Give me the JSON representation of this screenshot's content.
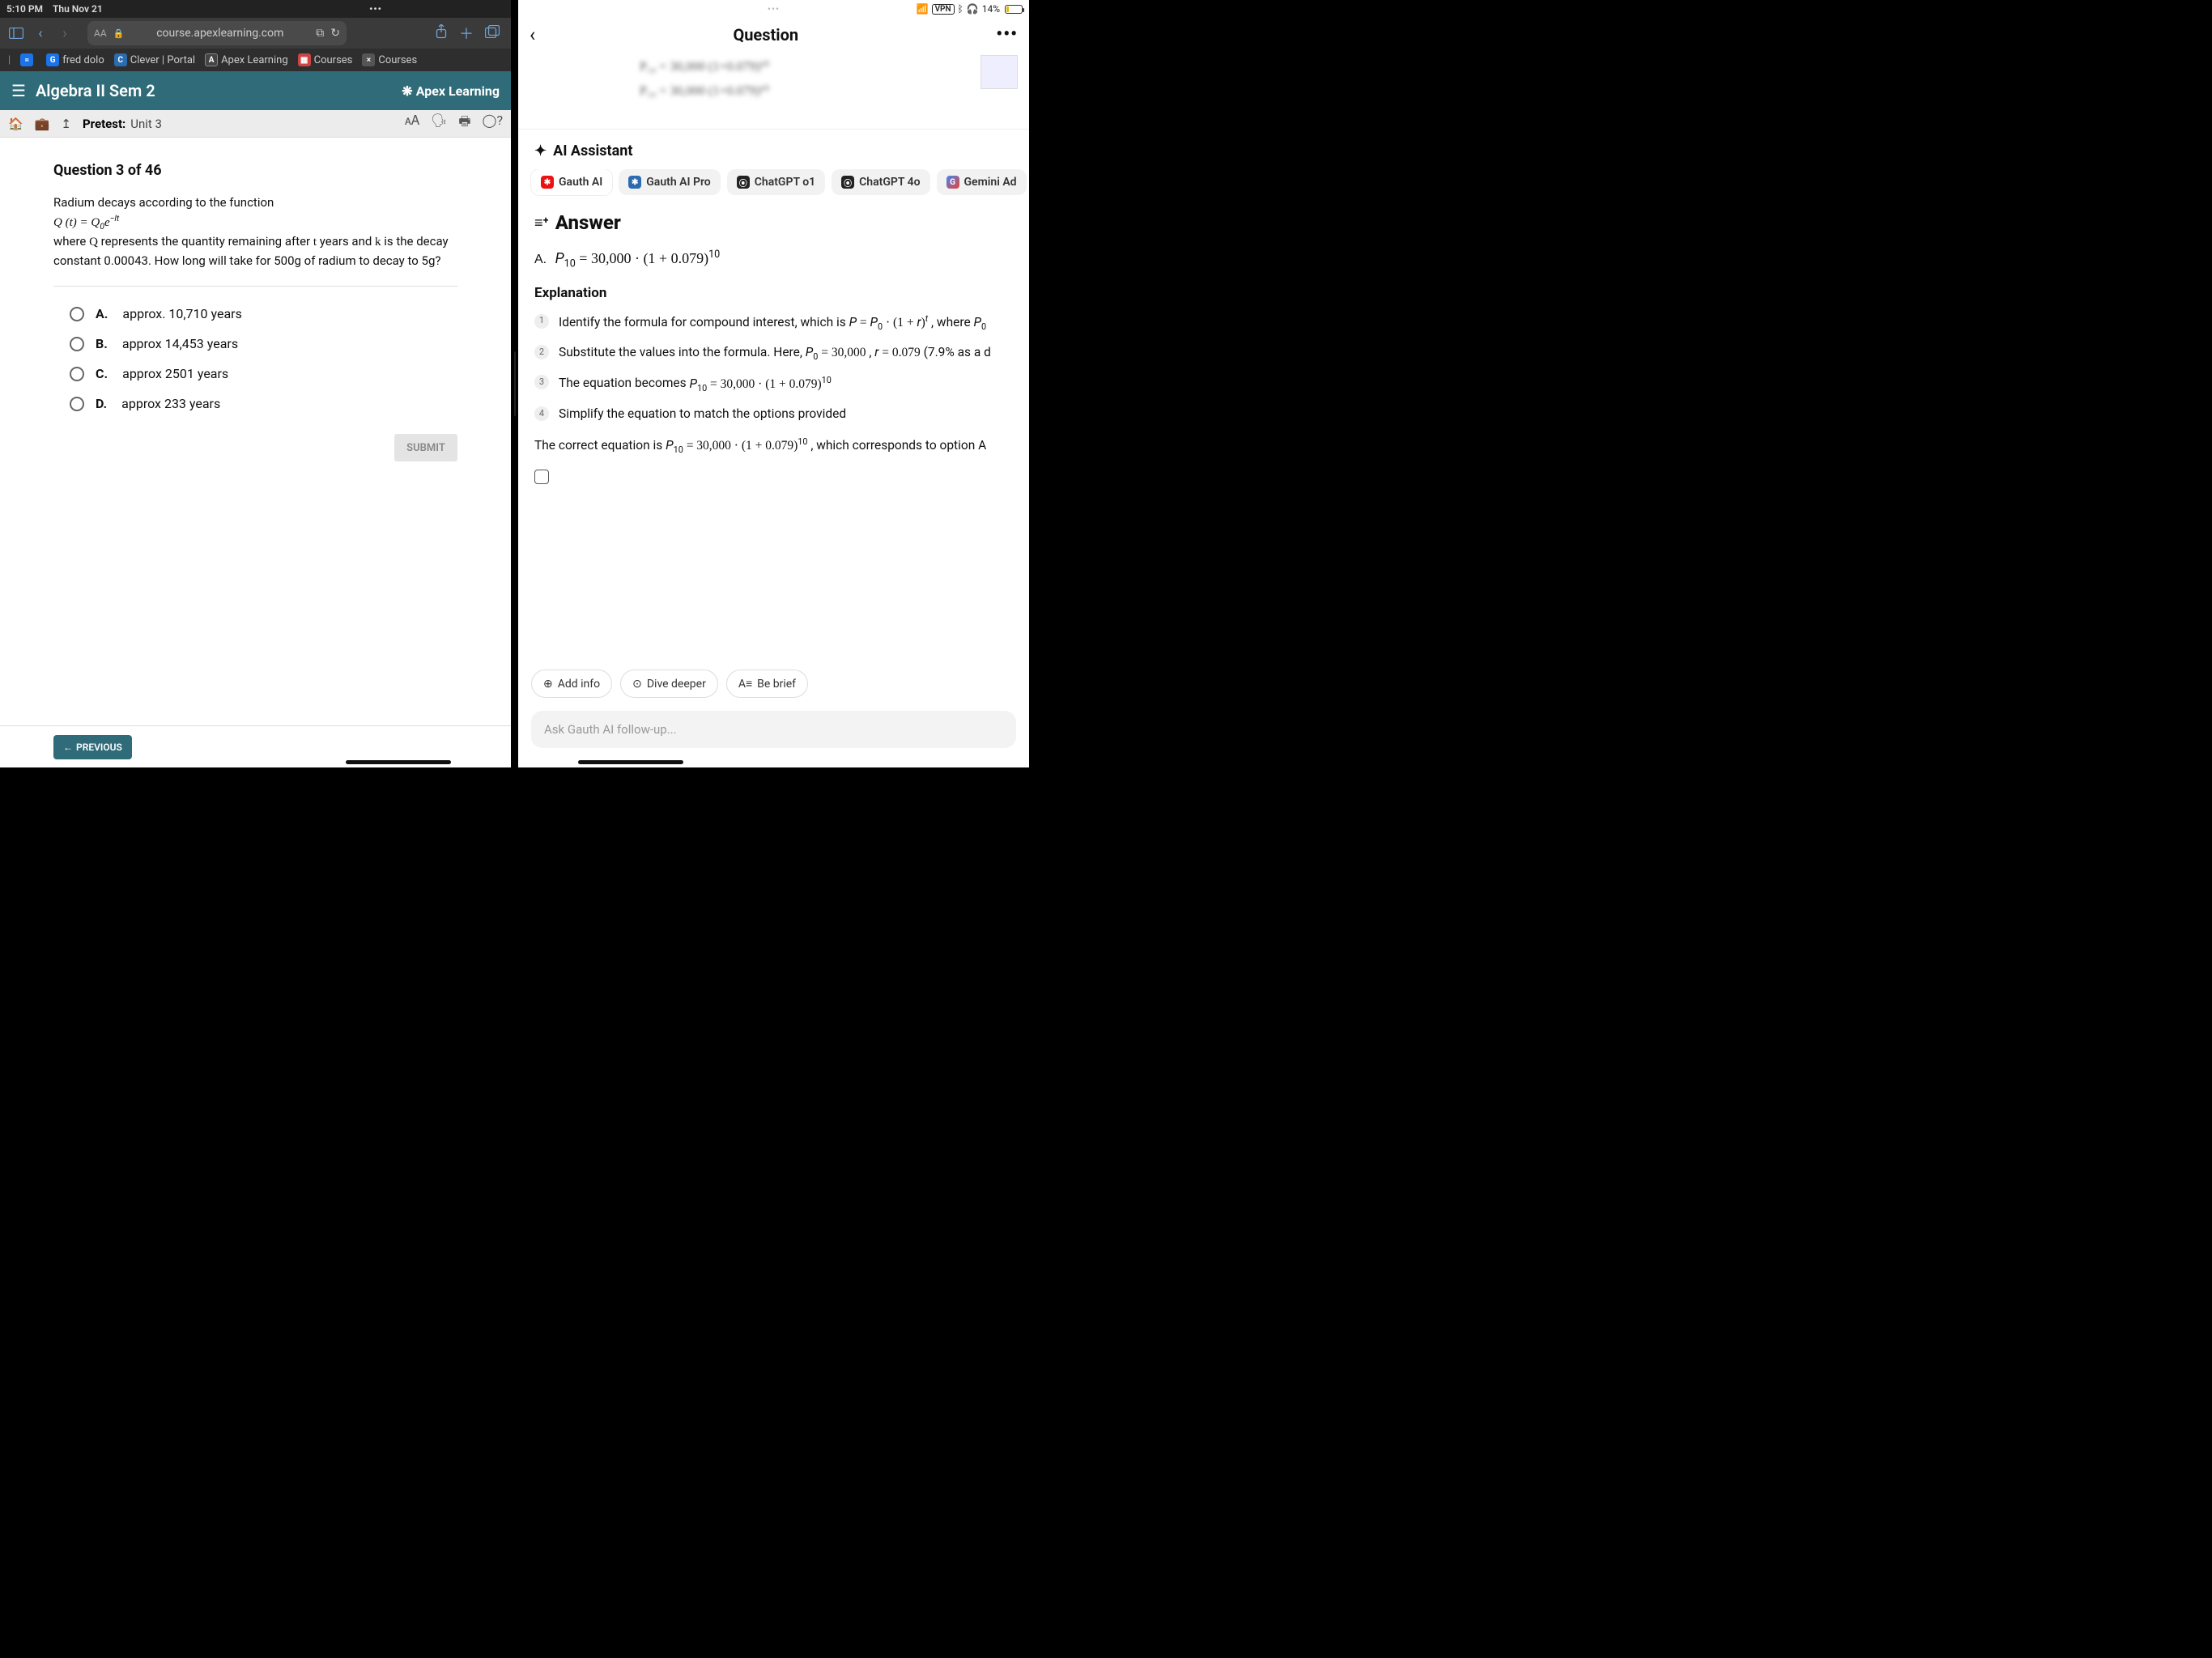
{
  "status": {
    "time": "5:10 PM",
    "date": "Thu Nov 21"
  },
  "browser": {
    "url": "course.apexlearning.com",
    "bookmarks": [
      {
        "icon_class": "bm-blue",
        "icon_txt": "=",
        "label": ""
      },
      {
        "icon_class": "bm-blue",
        "icon_txt": "G",
        "label": "fred dolo"
      },
      {
        "icon_class": "bm-clever",
        "icon_txt": "C",
        "label": "Clever | Portal"
      },
      {
        "icon_class": "bm-apex",
        "icon_txt": "A",
        "label": "Apex Learning"
      },
      {
        "icon_class": "bm-cal",
        "icon_txt": "▦",
        "label": "Courses"
      },
      {
        "icon_class": "bm-x",
        "icon_txt": "×",
        "label": "Courses"
      }
    ]
  },
  "course": {
    "title": "Algebra II Sem 2",
    "brand": "Apex Learning"
  },
  "crumb": {
    "label": "Pretest:",
    "unit": "Unit 3"
  },
  "question": {
    "counter": "Question 3 of 46",
    "prompt_l1": "Radium decays according to the function",
    "prompt_eq": "Q (t) = Q₀e⁻ˡᵗ",
    "prompt_l2a": "where ",
    "prompt_l2b": " represents the quantity remaining after ",
    "prompt_l2c": " years and ",
    "prompt_l2d": " is the decay constant 0.00043. How long will take for 500g of radium to decay to 5g?",
    "options": [
      {
        "letter": "A.",
        "text": "approx. 10,710 years"
      },
      {
        "letter": "B.",
        "text": "approx 14,453 years"
      },
      {
        "letter": "C.",
        "text": "approx 2501 years"
      },
      {
        "letter": "D.",
        "text": "approx 233 years"
      }
    ],
    "submit": "SUBMIT",
    "previous": "PREVIOUS"
  },
  "right_status": {
    "vpn": "VPN",
    "battery": "14%"
  },
  "right_header": {
    "title": "Question"
  },
  "ai": {
    "heading": "AI Assistant",
    "models": [
      {
        "ic": "mp-gauth",
        "glyph": "✱",
        "label": "Gauth AI",
        "active": true
      },
      {
        "ic": "mp-gauth2",
        "glyph": "✱",
        "label": "Gauth AI Pro",
        "active": false
      },
      {
        "ic": "mp-open",
        "glyph": "⦿",
        "label": "ChatGPT o1",
        "active": false
      },
      {
        "ic": "mp-open",
        "glyph": "⦿",
        "label": "ChatGPT 4o",
        "active": false
      },
      {
        "ic": "mp-gem",
        "glyph": "G",
        "label": "Gemini Ad",
        "active": false
      }
    ],
    "answer_heading": "Answer",
    "answer_line_lead": "A.",
    "answer_line_math": "P₁₀ = 30,000 · (1 + 0.079)¹⁰",
    "explanation_heading": "Explanation",
    "steps": [
      "Identify the formula for compound interest, which is  <span class='math'><i>P</i> = <i>P</i><sub>0</sub> · (1 + <i>r</i>)<sup><i>t</i></sup></span> , where  <span class='math'><i>P</i><sub>0</sub></span>",
      "Substitute the values into the formula. Here,  <span class='math'><i>P</i><sub>0</sub> = 30,000</span> ,  <span class='math'><i>r</i> = 0.079</span>  (7.9% as a d",
      "The equation becomes  <span class='math'><i>P</i><sub>10</sub> = 30,000 · (1 + 0.079)<sup>10</sup></span>",
      "Simplify the equation to match the options provided"
    ],
    "final_text": "The correct equation is  <span class='math'><i>P</i><sub>10</sub> = 30,000 · (1 + 0.079)<sup>10</sup></span> , which corresponds to option A",
    "actions": [
      {
        "glyph": "⊕",
        "label": "Add info"
      },
      {
        "glyph": "⊙",
        "label": "Dive deeper"
      },
      {
        "glyph": "A≡",
        "label": "Be brief"
      }
    ],
    "input_placeholder": "Ask Gauth AI follow-up..."
  }
}
